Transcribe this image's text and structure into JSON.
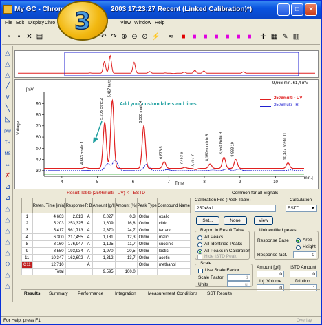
{
  "window": {
    "title_left": "My GC - Chromat",
    "title_right": "2003 17:23:27 Recent (Linked Calibration)*)",
    "minimize": "_",
    "maximize": "□",
    "close": "×"
  },
  "badge": {
    "number": "3"
  },
  "menu": {
    "items_left": [
      "File",
      "Edit",
      "Display",
      "Chro"
    ],
    "items_right": [
      "View",
      "Window",
      "Help"
    ]
  },
  "overview": {
    "readout": "9,666 min.  61,4 mV"
  },
  "chart": {
    "ylabel": "Voltage",
    "yunit": "[mV]",
    "xlabel": "Time",
    "xunit": "[min.]",
    "annotation": "Add your custom labels and lines",
    "legend": [
      {
        "name": "2506multi - UV",
        "color": "#E02020"
      },
      {
        "name": "2506multi - RI",
        "color": "#2020D0"
      }
    ]
  },
  "chart_data": {
    "type": "line",
    "title": "",
    "xlabel": "Time",
    "ylabel": "Voltage",
    "xlim": [
      3.5,
      10.8
    ],
    "ylim": [
      25,
      100
    ],
    "xticks": [
      4,
      5,
      6,
      7,
      8,
      9,
      10
    ],
    "yticks": [
      30,
      40,
      50,
      60,
      70,
      80,
      90
    ],
    "series": [
      {
        "name": "2506multi - UV",
        "color": "#E02020"
      },
      {
        "name": "2506multi - RI",
        "color": "#2020D0"
      }
    ],
    "peaks": [
      {
        "time": 4.663,
        "label": "4,663 oxalic 1",
        "height": 33
      },
      {
        "time": 5.203,
        "label": "5,203 citric 2",
        "height": 73
      },
      {
        "time": 5.417,
        "label": "5,417 tartaric 3",
        "height": 93
      },
      {
        "time": 6.3,
        "label": "6,300 malic 4",
        "height": 70
      },
      {
        "time": 6.873,
        "label": "6,873 5",
        "height": 38
      },
      {
        "time": 7.453,
        "label": "7,453 6",
        "height": 33
      },
      {
        "time": 7.757,
        "label": "7,757 7",
        "height": 31
      },
      {
        "time": 8.16,
        "label": "8,160 succinic 8",
        "height": 36
      },
      {
        "time": 8.55,
        "label": "8,550 lactic 9",
        "height": 42
      },
      {
        "time": 8.883,
        "label": "8,883 10",
        "height": 40
      },
      {
        "time": 10.347,
        "label": "10,347 acetic 11",
        "height": 37
      }
    ]
  },
  "result_table": {
    "title": "Result Table (2506multi - UV) <-- ESTD",
    "columns": [
      "",
      "Reten. Time [min]",
      "Response",
      "R B",
      "Amount [g/l]",
      "Amount [%]",
      "Peak Type",
      "Compound Name"
    ],
    "rows": [
      [
        "1",
        "4,663",
        "2,613",
        "A",
        "0,027",
        "0,3",
        "Ordnr",
        "oxalic"
      ],
      [
        "2",
        "5,203",
        "253,325",
        "A",
        "1,609",
        "16,8",
        "Ordnr",
        "citric"
      ],
      [
        "3",
        "5,417",
        "561,713",
        "A",
        "2,370",
        "24,7",
        "Ordnr",
        "tartaric"
      ],
      [
        "4",
        "6,300",
        "217,455",
        "A",
        "1,181",
        "12,3",
        "Ordnr",
        "malic"
      ],
      [
        "8",
        "8,160",
        "176,947",
        "A",
        "1,125",
        "11,7",
        "Ordnr",
        "succinic"
      ],
      [
        "9",
        "8,550",
        "193,934",
        "A",
        "1,970",
        "20,5",
        "Ordnr",
        "lactic"
      ],
      [
        "11",
        "10,347",
        "162,602",
        "A",
        "1,312",
        "13,7",
        "Ordnr",
        "acetic"
      ],
      [
        "C11",
        "12,710",
        "",
        "A",
        "",
        "",
        "Ordnr",
        "methanol"
      ],
      [
        "",
        "Total",
        "",
        "",
        "9,595",
        "100,0",
        "",
        ""
      ]
    ]
  },
  "right_panel": {
    "title": "Common for all Signals",
    "calib_label": "Calibration File (Peak Table)",
    "calib_value": "250x8x1",
    "calc_label": "Calculation",
    "calc_value": "ESTD",
    "set_btn": "Set...",
    "none_btn": "None",
    "view_btn": "View",
    "report_label": "Report in Result Table",
    "report_opts": [
      "All Peaks",
      "All Identified Peaks",
      "All Peaks in Calibration"
    ],
    "hide_istd": "Hide ISTD Peak",
    "unid_label": "Unidentified peaks",
    "resp_base": "Response Base",
    "area": "Area",
    "height": "Height",
    "resp_fact": "Response fact.",
    "resp_fact_val": "0",
    "scale_label": "Scale",
    "use_scale": "Use Scale Factor",
    "scale_factor": "Scale Factor",
    "scale_factor_val": "1",
    "units": "Units",
    "units_val": "ul",
    "amount_label": "Amount [g/l]",
    "amount_val": "0",
    "istd_label": "ISTD Amount",
    "istd_val": "0",
    "inj_label": "Inj. Volume",
    "inj_val": "0",
    "dil_label": "Dilution",
    "dil_val": "1"
  },
  "tabs": [
    "Results",
    "Summary",
    "Performance",
    "Integration",
    "Measurement Conditions",
    "SST Results"
  ],
  "status": {
    "help": "For Help, press F1",
    "overlay": "Overlay"
  }
}
